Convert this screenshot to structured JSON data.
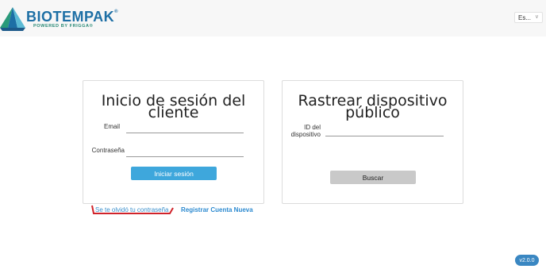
{
  "header": {
    "brand": "BIOTEMPAK",
    "brand_mark": "®",
    "tagline": "POWERED BY FRIGGA®",
    "language": "Es..."
  },
  "login": {
    "title": "Inicio de sesión del cliente",
    "email_label": "Email",
    "password_label": "Contraseña",
    "submit_label": "Iniciar sesión",
    "forgot_label": "Se te olvidó tu contraseña",
    "register_label": "Registrar Cuenta Nueva"
  },
  "tracking": {
    "title": "Rastrear dispositivo público",
    "device_id_label": "ID del dispositivo",
    "search_label": "Buscar"
  },
  "footer": {
    "version": "v2.0.0"
  },
  "colors": {
    "primary_button": "#3ea7dc",
    "secondary_button": "#c9c9c9",
    "brand_blue": "#1d6fa5",
    "version_badge": "#3a87c2",
    "annotation_red": "#d0232a"
  }
}
